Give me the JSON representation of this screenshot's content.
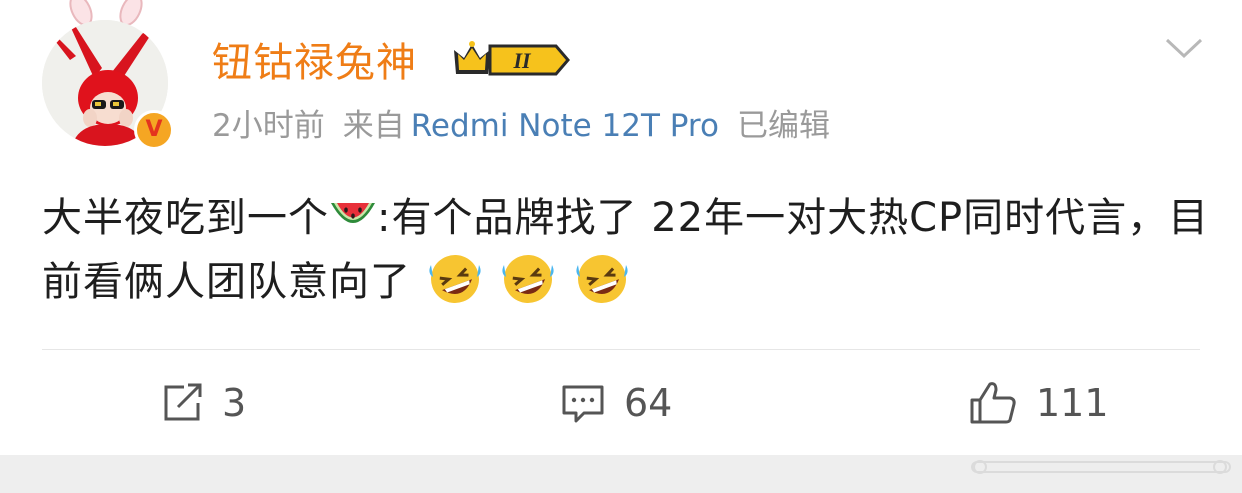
{
  "author": {
    "name": "钮钴禄兔神",
    "level_badge": "II",
    "verified_badge": "V",
    "avatar_icon": "avatar-girl-red-bunny-hat",
    "name_color": "#ef7d16"
  },
  "meta": {
    "time": "2小时前",
    "source_prefix": "来自",
    "device": "Redmi Note 12T Pro",
    "edited": "已编辑",
    "device_color": "#4a7fb5"
  },
  "content": {
    "part1": "大半夜吃到一个",
    "part2": ":有个品牌找了 22年一对大热CP同时代言，目前看俩人团队意向了",
    "emoji_watermelon": "watermelon-emoji",
    "emoji_laugh": "rolling-on-floor-laughing-emoji"
  },
  "actions": {
    "repost_count": "3",
    "comment_count": "64",
    "like_count": "111"
  }
}
